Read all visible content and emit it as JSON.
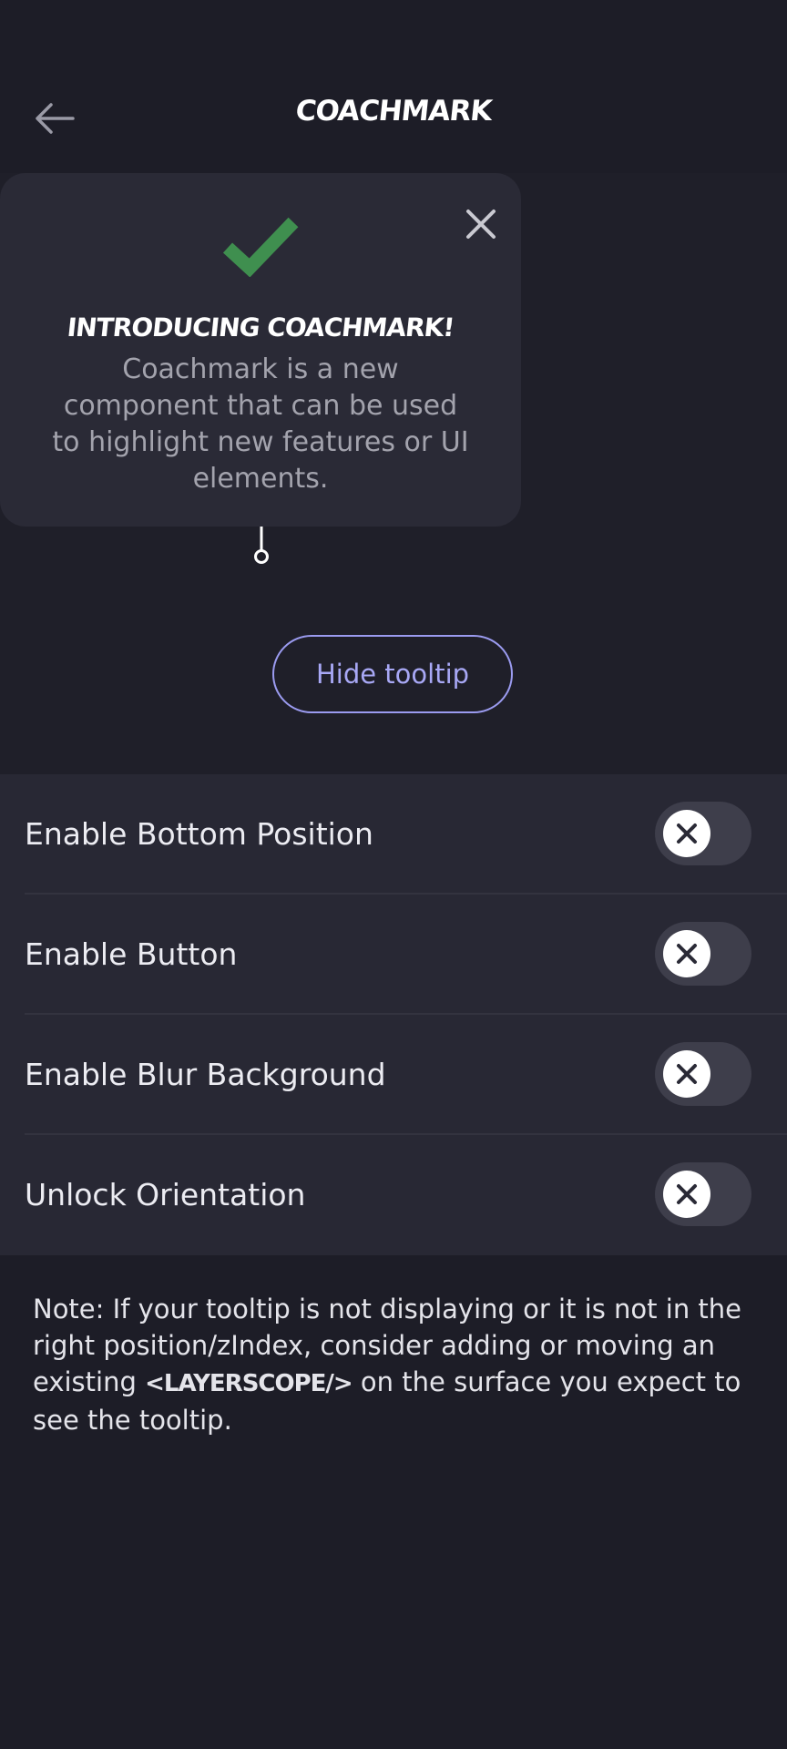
{
  "header": {
    "title": "COACHMARK",
    "back_icon": "arrow-left-icon"
  },
  "tooltip": {
    "icon": "check-icon",
    "icon_color": "#3f8f4f",
    "close_icon": "close-icon",
    "title": "INTRODUCING COACHMARK!",
    "body": "Coachmark is a new component that can be used to highlight new features or UI elements."
  },
  "actions": {
    "hide_tooltip_label": "Hide tooltip",
    "accent": "#a8a8f5"
  },
  "settings": [
    {
      "label": "Enable Bottom Position",
      "enabled": false
    },
    {
      "label": "Enable Button",
      "enabled": false
    },
    {
      "label": "Enable Blur Background",
      "enabled": false
    },
    {
      "label": "Unlock Orientation",
      "enabled": false
    }
  ],
  "note": {
    "prefix": "Note: If your tooltip is not displaying or it is not in the right position/zIndex, consider adding or moving an existing ",
    "code": "<LAYERSCOPE/>",
    "suffix": " on the surface you expect to see the tooltip."
  }
}
